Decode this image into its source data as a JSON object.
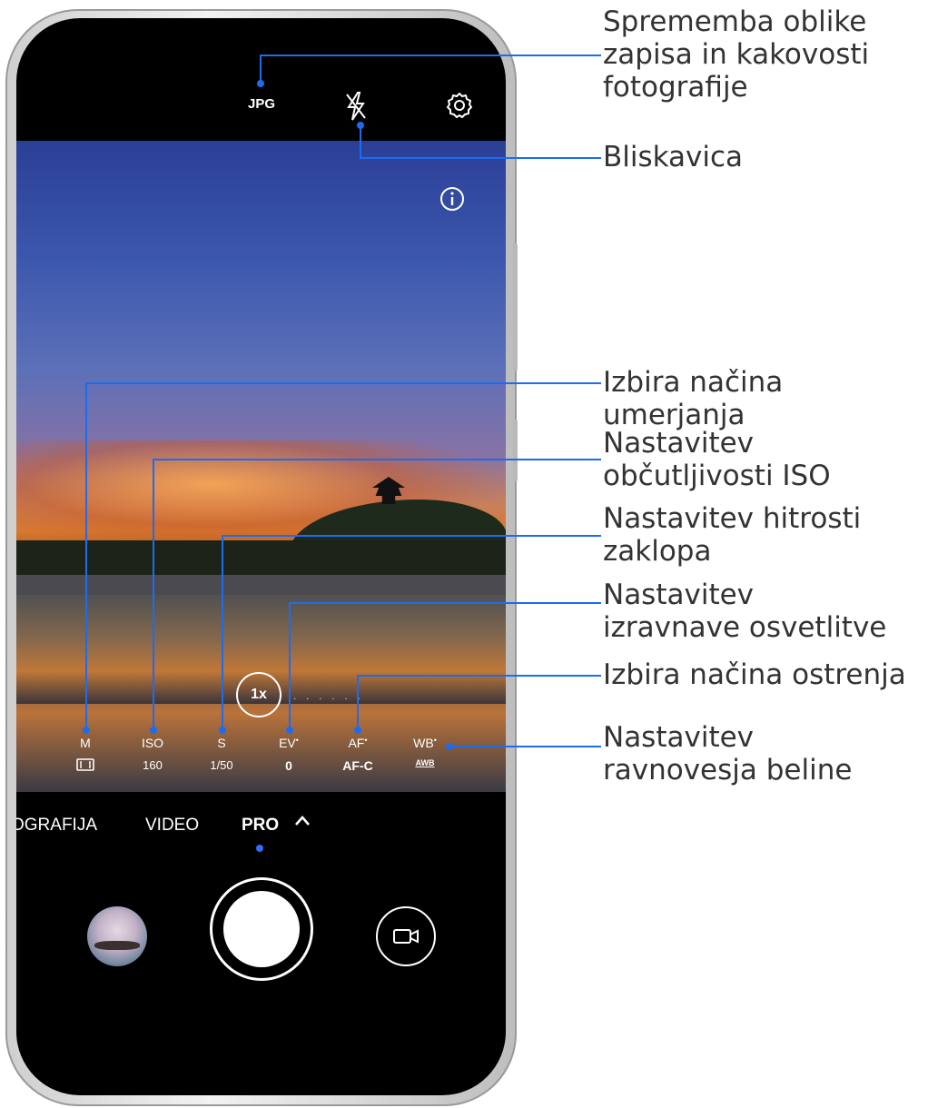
{
  "camera": {
    "top_bar": {
      "format_label": "JPG"
    },
    "modes": {
      "left_partial": "OGRAFIJA",
      "video": "VIDEO",
      "active": "PRO",
      "chevron": "^"
    },
    "zoom": {
      "label": "1x",
      "dots": "· · · · · ·"
    },
    "pro_params": [
      {
        "label": "M",
        "value": ""
      },
      {
        "label": "ISO",
        "value": "160"
      },
      {
        "label": "S",
        "value": "1/50"
      },
      {
        "label": "EV",
        "value": "0",
        "dot": "•"
      },
      {
        "label": "AF",
        "value": "AF-C",
        "dot": "•"
      },
      {
        "label": "WB",
        "value": "AWB",
        "dot": "•"
      }
    ],
    "icons": [
      "flash-off-icon",
      "settings-icon",
      "info-icon",
      "metering-icon",
      "video-camera-icon"
    ]
  },
  "annotations": [
    {
      "lines": [
        "Sprememba oblike",
        "zapisa in kakovosti",
        "fotografije"
      ]
    },
    {
      "lines": [
        "Bliskavica"
      ]
    },
    {
      "lines": [
        "Izbira načina umerjanja"
      ]
    },
    {
      "lines": [
        "Nastavitev",
        "občutljivosti ISO"
      ]
    },
    {
      "lines": [
        "Nastavitev hitrosti",
        "zaklopa"
      ]
    },
    {
      "lines": [
        "Nastavitev",
        "izravnave osvetlitve"
      ]
    },
    {
      "lines": [
        "Izbira načina ostrenja"
      ]
    },
    {
      "lines": [
        "Nastavitev",
        "ravnovesja beline"
      ]
    }
  ],
  "colors": {
    "callout": "#1c6cf0",
    "active_mode_dot": "#2f6cff"
  }
}
